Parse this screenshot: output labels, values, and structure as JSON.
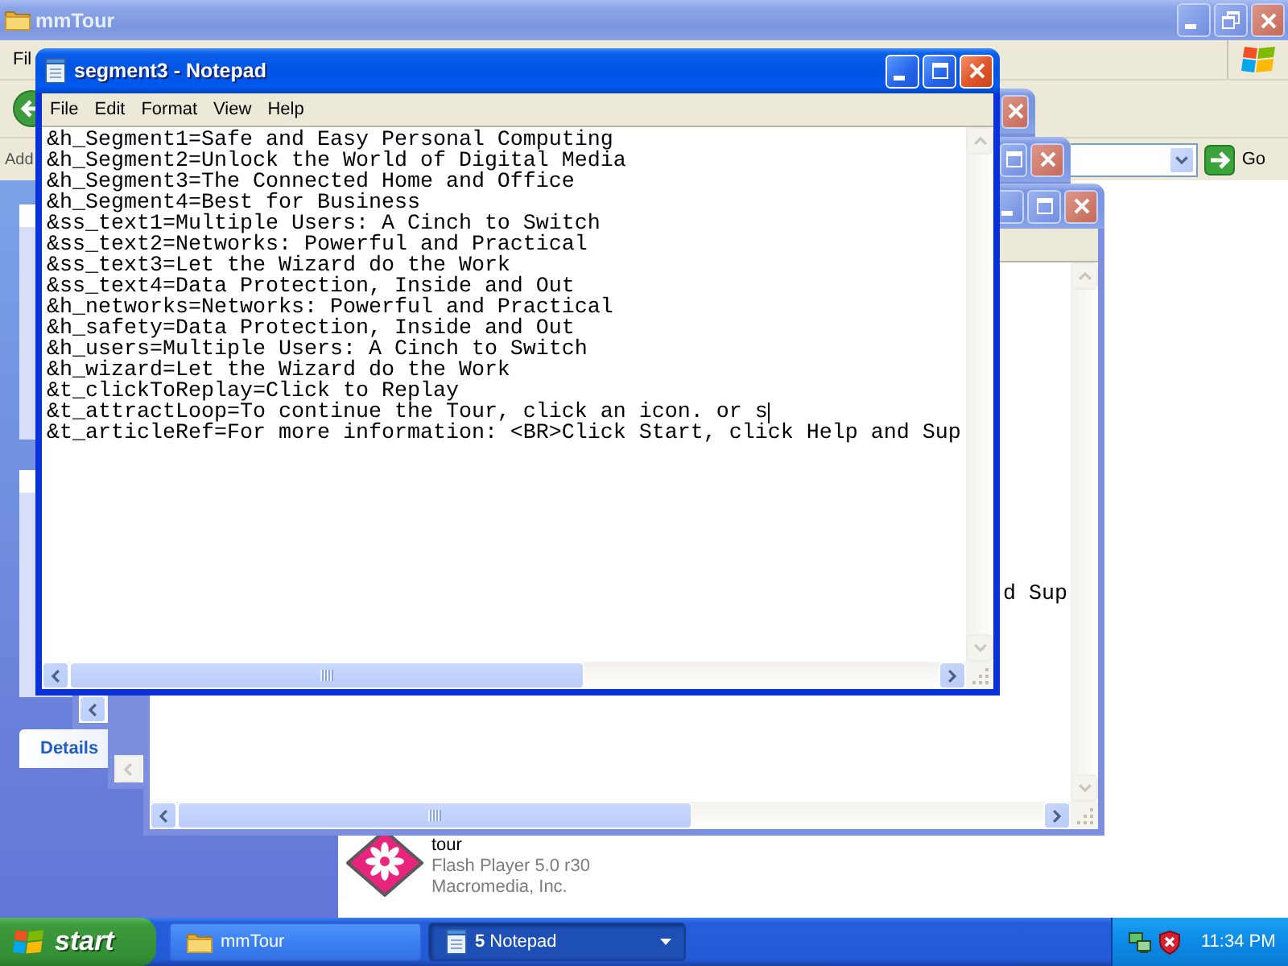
{
  "explorer": {
    "title": "mmTour",
    "menu_fragment": "Fil",
    "address_label": "Add",
    "go_label": "Go",
    "task_pane_header": "Details",
    "file_item": {
      "name": "tour",
      "file_type": "Flash Player 5.0 r30",
      "company": "Macromedia, Inc."
    }
  },
  "background_window": {
    "text_fragment": "d Sup"
  },
  "notepad": {
    "title": "segment3 - Notepad",
    "menu": [
      "File",
      "Edit",
      "Format",
      "View",
      "Help"
    ],
    "lines": [
      {
        "text": "&h_Segment1=Safe and Easy Personal Computing",
        "caret": false
      },
      {
        "text": "&h_Segment2=Unlock the World of Digital Media",
        "caret": false
      },
      {
        "text": "&h_Segment3=The Connected Home and Office",
        "caret": false
      },
      {
        "text": "&h_Segment4=Best for Business",
        "caret": false
      },
      {
        "text": "&ss_text1=Multiple Users: A Cinch to Switch",
        "caret": false
      },
      {
        "text": "&ss_text2=Networks: Powerful and Practical",
        "caret": false
      },
      {
        "text": "&ss_text3=Let the Wizard do the Work",
        "caret": false
      },
      {
        "text": "&ss_text4=Data Protection, Inside and Out",
        "caret": false
      },
      {
        "text": "&h_networks=Networks: Powerful and Practical",
        "caret": false
      },
      {
        "text": "&h_safety=Data Protection, Inside and Out",
        "caret": false
      },
      {
        "text": "&h_users=Multiple Users: A Cinch to Switch",
        "caret": false
      },
      {
        "text": "&h_wizard=Let the Wizard do the Work",
        "caret": false
      },
      {
        "text": "&t_clickToReplay=Click to Replay",
        "caret": false
      },
      {
        "text": "&t_attractLoop=To continue the Tour, click an icon. or s",
        "caret": true
      },
      {
        "text": "&t_articleRef=For more information: <BR>Click Start, click Help and Sup",
        "caret": false
      }
    ]
  },
  "taskbar": {
    "start": "start",
    "tasks": [
      {
        "kind": "folder",
        "label": "mmTour",
        "selected": false
      },
      {
        "kind": "group",
        "label": "**5** Notepad",
        "selected": true
      }
    ],
    "clock": "11:34 PM"
  }
}
